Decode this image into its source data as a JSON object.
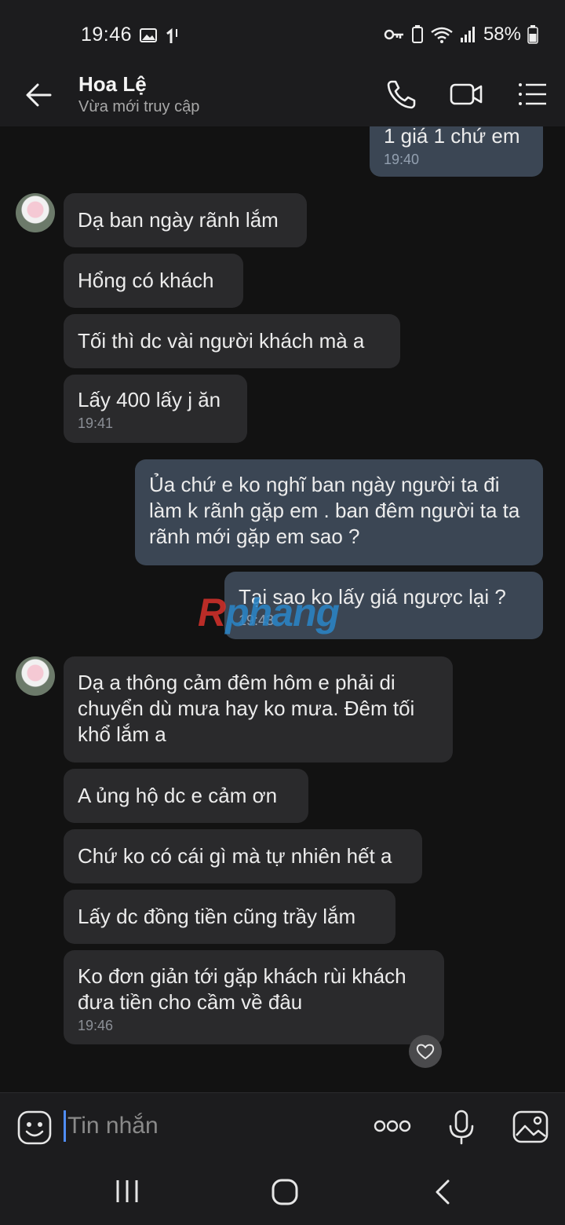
{
  "status_bar": {
    "time": "19:46",
    "battery": "58%"
  },
  "header": {
    "contact_name": "Hoa Lệ",
    "contact_status": "Vừa mới truy cập",
    "icons": [
      "back-arrow-icon",
      "phone-icon",
      "video-camera-icon",
      "menu-list-icon"
    ]
  },
  "messages": [
    {
      "direction": "out",
      "text": "1 giá 1 chứ em",
      "time": "19:40"
    },
    {
      "direction": "in",
      "text": "Dạ ban ngày rãnh lắm"
    },
    {
      "direction": "in",
      "text": "Hổng có khách"
    },
    {
      "direction": "in",
      "text": "Tối thì dc vài người khách mà a"
    },
    {
      "direction": "in",
      "text": "Lấy 400 lấy j ăn",
      "time": "19:41"
    },
    {
      "direction": "out",
      "text": "Ủa chứ e ko nghĩ ban ngày người ta đi làm k rãnh gặp em .  ban đêm người ta ta rãnh mới gặp em sao ?"
    },
    {
      "direction": "out",
      "text": "Tại sao ko lấy giá  ngược lại ?",
      "time": "19:43"
    },
    {
      "direction": "in",
      "text": "Dạ a thông cảm đêm hôm e phải di chuyển dù mưa hay ko mưa. Đêm tối khổ lắm a"
    },
    {
      "direction": "in",
      "text": "A ủng hộ dc e cảm ơn"
    },
    {
      "direction": "in",
      "text": "Chứ ko có cái gì mà tự nhiên hết a"
    },
    {
      "direction": "in",
      "text": "Lấy dc đồng tiền cũng trầy lắm"
    },
    {
      "direction": "in",
      "text": "Ko đơn giản tới gặp khách rùi khách đưa tiền cho cầm về đâu",
      "time": "19:46"
    }
  ],
  "watermark": {
    "first": "R",
    "rest": "phang"
  },
  "input": {
    "placeholder": "Tin nhắn"
  },
  "colors": {
    "background": "#121212",
    "incoming_bubble": "#2a2a2c",
    "outgoing_bubble": "#3b4654",
    "cursor": "#4f8df7"
  }
}
